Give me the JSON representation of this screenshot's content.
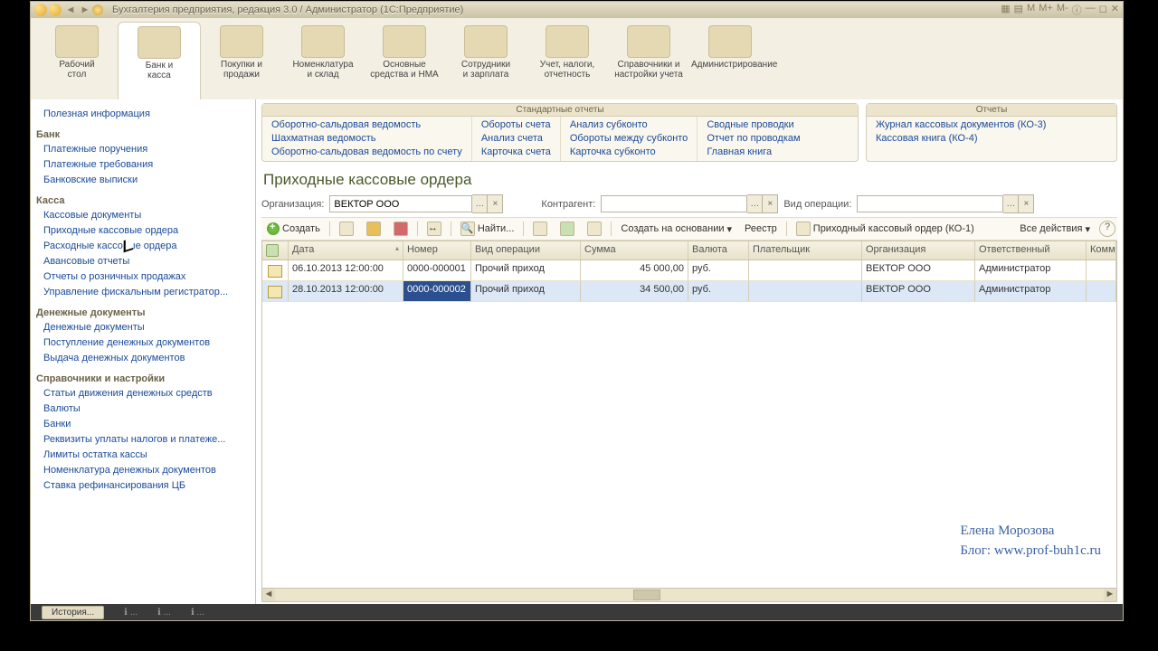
{
  "title": "Бухгалтерия предприятия, редакция 3.0 / Администратор   (1С:Предприятие)",
  "mainTabs": [
    {
      "l1": "Рабочий",
      "l2": "стол"
    },
    {
      "l1": "Банк и",
      "l2": "касса"
    },
    {
      "l1": "Покупки и",
      "l2": "продажи"
    },
    {
      "l1": "Номенклатура",
      "l2": "и склад"
    },
    {
      "l1": "Основные",
      "l2": "средства и НМА"
    },
    {
      "l1": "Сотрудники",
      "l2": "и зарплата"
    },
    {
      "l1": "Учет, налоги,",
      "l2": "отчетность"
    },
    {
      "l1": "Справочники и",
      "l2": "настройки учета"
    },
    {
      "l1": "Администрирование",
      "l2": ""
    }
  ],
  "side": {
    "top": "Полезная информация",
    "groups": [
      {
        "t": "Банк",
        "items": [
          "Платежные поручения",
          "Платежные требования",
          "Банковские выписки"
        ]
      },
      {
        "t": "Касса",
        "items": [
          "Кассовые документы",
          "Приходные кассовые ордера",
          "Расходные кассовые ордера",
          "Авансовые отчеты",
          "Отчеты о розничных продажах",
          "Управление фискальным регистратор..."
        ]
      },
      {
        "t": "Денежные документы",
        "items": [
          "Денежные документы",
          "Поступление денежных документов",
          "Выдача денежных документов"
        ]
      },
      {
        "t": "Справочники и настройки",
        "items": [
          "Статьи движения денежных средств",
          "Валюты",
          "Банки",
          "Реквизиты уплаты налогов и платеже...",
          "Лимиты остатка кассы",
          "Номенклатура денежных документов",
          "Ставка рефинансирования ЦБ"
        ]
      }
    ]
  },
  "stdReports": {
    "hdr": "Стандартные отчеты",
    "cols": [
      [
        "Оборотно-сальдовая ведомость",
        "Шахматная ведомость",
        "Оборотно-сальдовая ведомость по счету"
      ],
      [
        "Обороты счета",
        "Анализ счета",
        "Карточка счета"
      ],
      [
        "Анализ субконто",
        "Обороты между субконто",
        "Карточка субконто"
      ],
      [
        "Сводные проводки",
        "Отчет по проводкам",
        "Главная книга"
      ]
    ]
  },
  "reports": {
    "hdr": "Отчеты",
    "items": [
      "Журнал кассовых документов (КО-3)",
      "Кассовая книга (КО-4)"
    ]
  },
  "page": {
    "title": "Приходные кассовые ордера",
    "orgLabel": "Организация:",
    "orgValue": "ВЕКТОР ООО",
    "kaLabel": "Контрагент:",
    "opLabel": "Вид операции:"
  },
  "tb": {
    "create": "Создать",
    "find": "Найти...",
    "basis": "Создать на основании",
    "reestr": "Реестр",
    "print": "Приходный кассовый ордер (КО-1)",
    "all": "Все действия"
  },
  "grid": {
    "cols": {
      "date": "Дата",
      "num": "Номер",
      "op": "Вид операции",
      "sum": "Сумма",
      "cur": "Валюта",
      "payer": "Плательщик",
      "org": "Организация",
      "res": "Ответственный",
      "com": "Коммент"
    },
    "rows": [
      {
        "date": "06.10.2013 12:00:00",
        "num": "0000-000001",
        "op": "Прочий приход",
        "sum": "45 000,00",
        "cur": "руб.",
        "payer": "",
        "org": "ВЕКТОР ООО",
        "res": "Администратор"
      },
      {
        "date": "28.10.2013 12:00:00",
        "num": "0000-000002",
        "op": "Прочий приход",
        "sum": "34 500,00",
        "cur": "руб.",
        "payer": "",
        "org": "ВЕКТОР ООО",
        "res": "Администратор"
      }
    ]
  },
  "watermark": {
    "l1": "Елена Морозова",
    "l2": "Блог: www.prof-buh1c.ru"
  },
  "status": {
    "history": "История..."
  }
}
